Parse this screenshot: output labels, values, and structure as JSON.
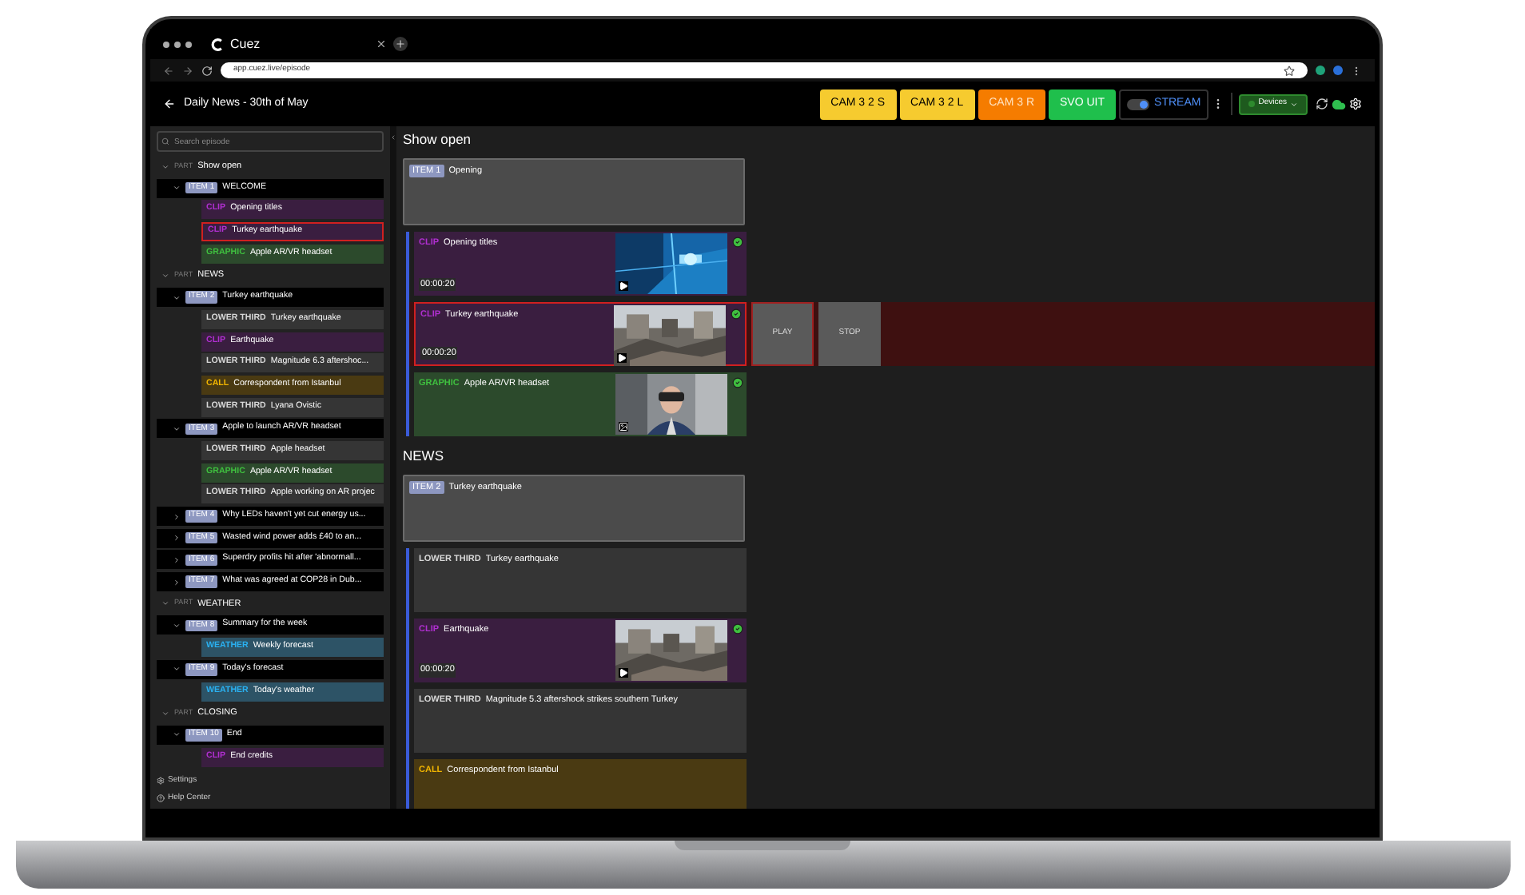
{
  "browser": {
    "tab_title": "Cuez",
    "url": "app.cuez.live/episode"
  },
  "header": {
    "back_label": "Daily News - 30th of May",
    "buttons": [
      {
        "label": "CAM 3 2 S",
        "color": "#f6cb2f"
      },
      {
        "label": "CAM 3 2 L",
        "color": "#f6cb2f"
      },
      {
        "label": "CAM 3 R",
        "color": "#f57c00"
      },
      {
        "label": "SVO UIT",
        "color": "#1fbf4c"
      }
    ],
    "stream": {
      "label": "STREAM",
      "on": true
    },
    "devices": "Devices"
  },
  "sidebar": {
    "search_placeholder": "Search episode",
    "parts": [
      {
        "label": "PART",
        "title": "Show open",
        "expanded": true,
        "items": [
          {
            "label": "ITEM 1",
            "title": "WELCOME",
            "expanded": true,
            "children": [
              {
                "kind": "clip",
                "type_label": "CLIP",
                "title": "Opening titles",
                "selected": false
              },
              {
                "kind": "clip",
                "type_label": "CLIP",
                "title": "Turkey earthquake",
                "selected": true
              },
              {
                "kind": "graphic",
                "type_label": "GRAPHIC",
                "title": "Apple AR/VR headset",
                "selected": false
              }
            ]
          }
        ]
      },
      {
        "label": "PART",
        "title": "NEWS",
        "expanded": true,
        "items": [
          {
            "label": "ITEM 2",
            "title": "Turkey earthquake",
            "expanded": true,
            "children": [
              {
                "kind": "lower_third",
                "type_label": "LOWER THIRD",
                "title": "Turkey earthquake",
                "selected": false
              },
              {
                "kind": "clip",
                "type_label": "CLIP",
                "title": "Earthquake",
                "selected": false
              },
              {
                "kind": "lower_third",
                "type_label": "LOWER THIRD",
                "title": "Magnitude 6.3 aftershoc...",
                "selected": false
              },
              {
                "kind": "call",
                "type_label": "CALL",
                "title": "Correspondent from Istanbul",
                "selected": false
              },
              {
                "kind": "lower_third",
                "type_label": "LOWER THIRD",
                "title": "Lyana Ovistic",
                "selected": false
              }
            ]
          },
          {
            "label": "ITEM 3",
            "title": "Apple to launch AR/VR headset",
            "expanded": true,
            "children": [
              {
                "kind": "lower_third",
                "type_label": "LOWER THIRD",
                "title": "Apple headset",
                "selected": false
              },
              {
                "kind": "graphic",
                "type_label": "GRAPHIC",
                "title": "Apple AR/VR headset",
                "selected": false
              },
              {
                "kind": "lower_third",
                "type_label": "LOWER THIRD",
                "title": "Apple working on AR projec",
                "selected": false
              }
            ]
          },
          {
            "label": "ITEM 4",
            "title": "Why LEDs haven't yet cut energy us...",
            "expanded": false
          },
          {
            "label": "ITEM 5",
            "title": "Wasted wind power adds £40 to an...",
            "expanded": false
          },
          {
            "label": "ITEM 6",
            "title": "Superdry profits hit after 'abnormall...",
            "expanded": false
          },
          {
            "label": "ITEM 7",
            "title": "What was agreed at COP28 in Dub...",
            "expanded": false
          }
        ]
      },
      {
        "label": "PART",
        "title": "WEATHER",
        "expanded": true,
        "items": [
          {
            "label": "ITEM 8",
            "title": "Summary for the week",
            "expanded": true,
            "children": [
              {
                "kind": "weather",
                "type_label": "WEATHER",
                "title": "Weekly forecast",
                "selected": false
              }
            ]
          },
          {
            "label": "ITEM 9",
            "title": "Today's forecast",
            "expanded": true,
            "children": [
              {
                "kind": "weather",
                "type_label": "WEATHER",
                "title": "Today's weather",
                "selected": false
              }
            ]
          }
        ]
      },
      {
        "label": "PART",
        "title": "CLOSING",
        "expanded": true,
        "items": [
          {
            "label": "ITEM 10",
            "title": "End",
            "expanded": true,
            "children": [
              {
                "kind": "clip",
                "type_label": "CLIP",
                "title": "End credits",
                "selected": false
              }
            ]
          }
        ]
      }
    ],
    "footer": [
      {
        "kind": "settings",
        "label": "Settings"
      },
      {
        "kind": "help",
        "label": "Help Center"
      }
    ]
  },
  "main": {
    "sections": [
      {
        "title": "Show open",
        "item": {
          "label": "ITEM 1",
          "title": "Opening"
        },
        "cards": [
          {
            "kind": "clip",
            "type_label": "CLIP",
            "title": "Opening titles",
            "duration": "00:00:20",
            "picture": true,
            "ready": true,
            "selected": false
          },
          {
            "kind": "clip",
            "type_label": "CLIP",
            "title": "Turkey earthquake",
            "duration": "00:00:20",
            "picture": true,
            "ready": true,
            "selected": true,
            "actions": [
              "PLAY",
              "STOP"
            ]
          },
          {
            "kind": "graphic",
            "type_label": "GRAPHIC",
            "title": "Apple AR/VR headset",
            "picture": true,
            "ready": true,
            "selected": false
          }
        ]
      },
      {
        "title": "NEWS",
        "item": {
          "label": "ITEM 2",
          "title": "Turkey earthquake"
        },
        "cards": [
          {
            "kind": "lower_third",
            "type_label": "LOWER THIRD",
            "title": "Turkey earthquake",
            "picture": false,
            "ready": false,
            "selected": false
          },
          {
            "kind": "clip",
            "type_label": "CLIP",
            "title": "Earthquake",
            "duration": "00:00:20",
            "picture": true,
            "ready": true,
            "selected": false
          },
          {
            "kind": "lower_third",
            "type_label": "LOWER THIRD",
            "title": "Magnitude 5.3 aftershock strikes southern Turkey",
            "picture": false,
            "ready": false,
            "selected": false
          },
          {
            "kind": "call",
            "type_label": "CALL",
            "title": "Correspondent from Istanbul",
            "picture": false,
            "ready": false,
            "selected": false
          }
        ]
      }
    ]
  }
}
